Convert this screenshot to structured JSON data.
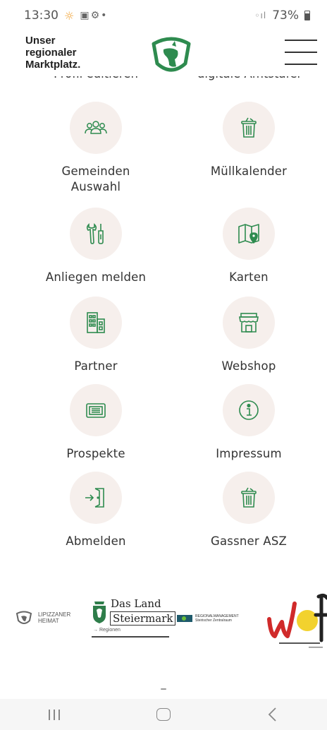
{
  "status_bar": {
    "time": "13:30",
    "battery": "73%",
    "icons": [
      "sun-icon",
      "gallery-icon",
      "people-icon",
      "dot-icon",
      "wifi-icon",
      "signal-icon",
      "battery-icon"
    ]
  },
  "header": {
    "brand_text": "Unser regionaler Marktplatz.",
    "menu_icon": "hamburger-menu-icon"
  },
  "tiles_top_clipped": {
    "left_label": "Profil editieren",
    "right_label": "digitale Amtstafel"
  },
  "tiles": [
    {
      "label": "Gemeinden Auswahl",
      "icon": "people-group-icon"
    },
    {
      "label": "Müllkalender",
      "icon": "trash-bin-icon"
    },
    {
      "label": "Anliegen melden",
      "icon": "tools-icon"
    },
    {
      "label": "Karten",
      "icon": "map-pin-icon"
    },
    {
      "label": "Partner",
      "icon": "building-icon"
    },
    {
      "label": "Webshop",
      "icon": "shop-icon"
    },
    {
      "label": "Prospekte",
      "icon": "newspaper-icon"
    },
    {
      "label": "Impressum",
      "icon": "info-icon"
    },
    {
      "label": "Abmelden",
      "icon": "logout-door-icon"
    },
    {
      "label": "Gassner ASZ",
      "icon": "trash-bin-icon"
    }
  ],
  "partners": {
    "lipizzaner": {
      "line1": "LIPIZZANER",
      "line2": "HEIMAT"
    },
    "land_steiermark": {
      "line1": "Das Land",
      "line2": "Steiermark",
      "line3": "→ Regionen"
    },
    "regionalmanagement": {
      "line1": "REGIONALMANAGEMENT",
      "line2": "Steirischer Zentralraum"
    }
  },
  "colors": {
    "brand_green": "#2e8b4f",
    "icon_circle": "#f6efec",
    "text": "#333333"
  }
}
